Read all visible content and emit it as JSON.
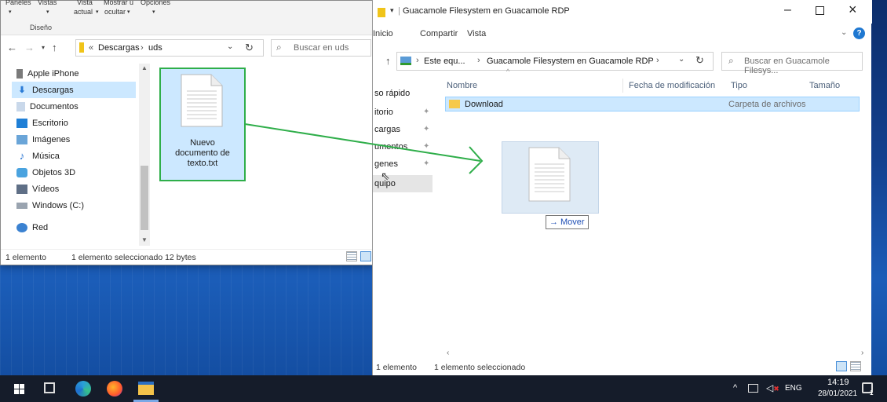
{
  "left_window": {
    "ribbon": {
      "paneles": "Paneles",
      "vistas": "Vistas",
      "vista_actual": "Vista",
      "actual": "actual",
      "mostrar": "Mostrar u",
      "ocultar": "ocultar",
      "opciones": "Opciones",
      "diseno": "Diseño"
    },
    "address": {
      "prefix": "«",
      "crumb1": "Descargas",
      "crumb2": "uds"
    },
    "search_placeholder": "Buscar en uds",
    "nav_items": [
      "Apple iPhone",
      "Descargas",
      "Documentos",
      "Escritorio",
      "Imágenes",
      "Música",
      "Objetos 3D",
      "Vídeos",
      "Windows (C:)",
      "Red"
    ],
    "file": {
      "line1": "Nuevo",
      "line2": "documento de",
      "line3": "texto.txt"
    },
    "status": {
      "count": "1 elemento",
      "selected": "1 elemento seleccionado  12 bytes"
    }
  },
  "right_window": {
    "title": "Guacamole Filesystem en Guacamole RDP",
    "ribbon": {
      "inicio": "Inicio",
      "compartir": "Compartir",
      "vista": "Vista"
    },
    "address": {
      "crumb1": "Este equ...",
      "crumb2": "Guacamole Filesystem en Guacamole RDP"
    },
    "search_placeholder": "Buscar en Guacamole Filesys...",
    "nav_items": [
      "so rápido",
      "itorio",
      "cargas",
      "umentos",
      "genes",
      "quipo"
    ],
    "columns": {
      "name": "Nombre",
      "modified": "Fecha de modificación",
      "type": "Tipo",
      "size": "Tamaño"
    },
    "rows": [
      {
        "name": "Download",
        "type": "Carpeta de archivos"
      }
    ],
    "drag_tooltip": "Mover",
    "status": {
      "count": "1 elemento",
      "selected": "1 elemento seleccionado"
    }
  },
  "taskbar": {
    "language": "ENG",
    "time": "14:19",
    "date": "28/01/2021",
    "notification_count": "1"
  },
  "colors": {
    "selection": "#cce8ff",
    "annotation_green": "#2fae4a",
    "taskbar": "#151c2a"
  }
}
